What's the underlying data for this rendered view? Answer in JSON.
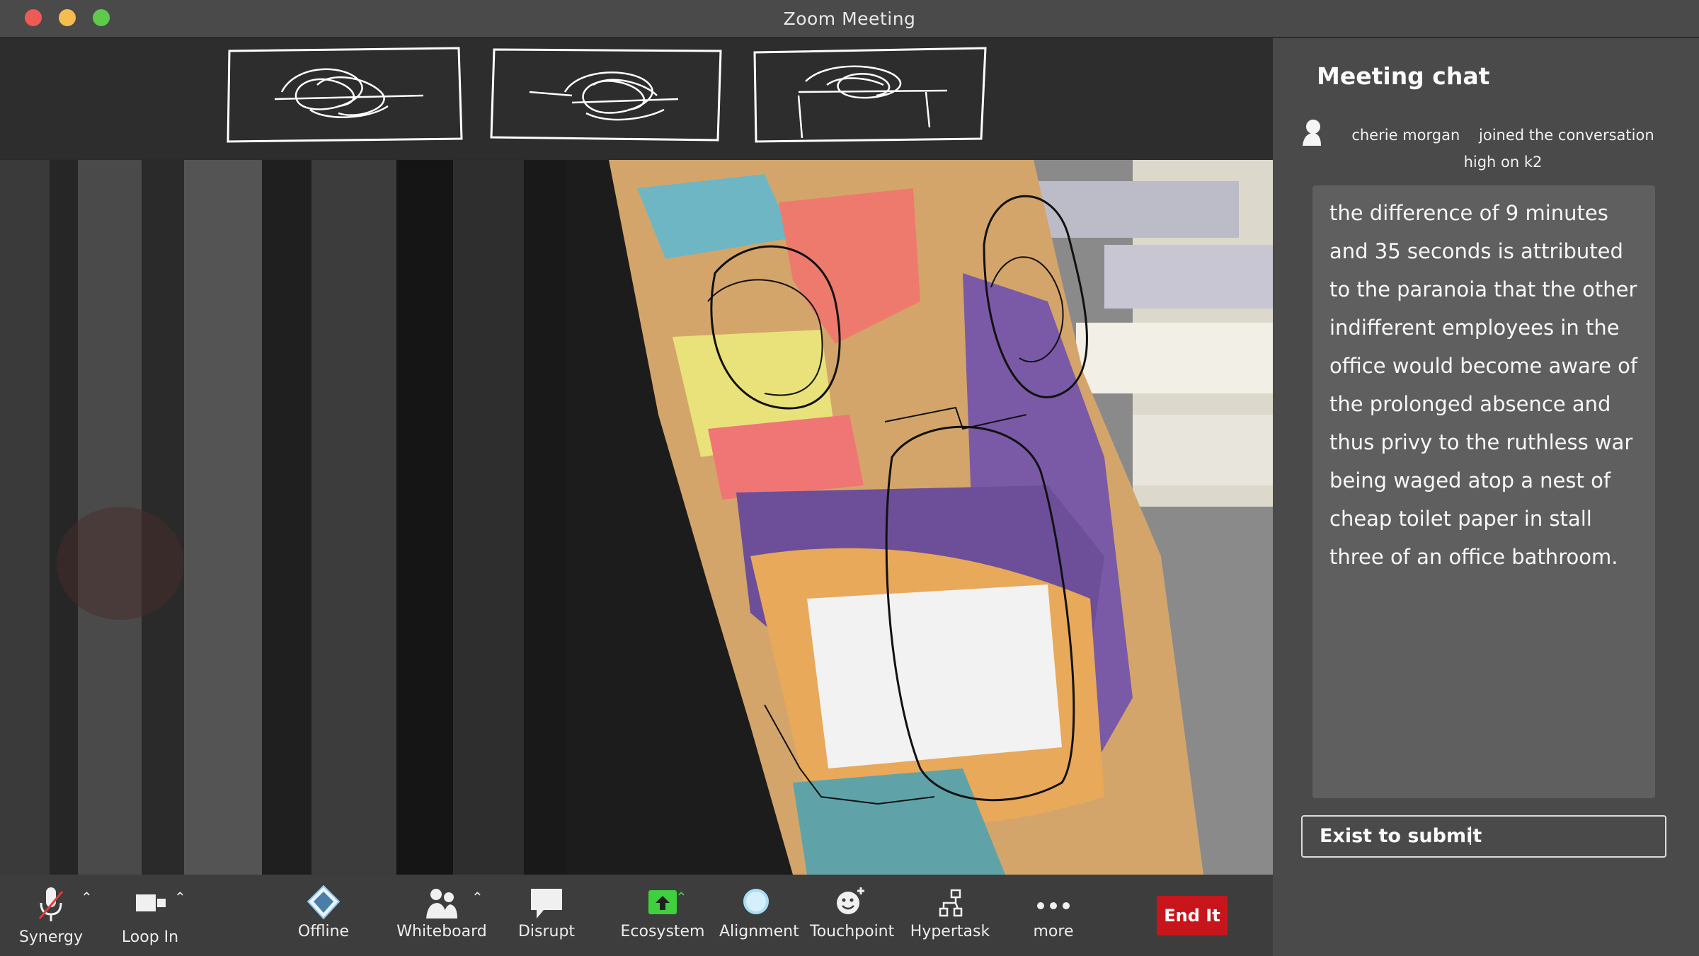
{
  "window": {
    "title": "Zoom Meeting"
  },
  "colors": {
    "end_button": "#c8151c",
    "ecosystem_accent": "#3fcf3f",
    "alignment_accent": "#a8dcf7",
    "chat_panel": "#4a4a4a",
    "message_box": "#5f5f5f"
  },
  "thumbnails": [
    {
      "icon": "scribble-face-thumbnail"
    },
    {
      "icon": "scribble-face-thumbnail"
    },
    {
      "icon": "scribble-face-thumbnail"
    }
  ],
  "chat": {
    "title": "Meeting chat",
    "join": {
      "name": "cherie morgan",
      "action": "joined the conversation",
      "location": "high on k2"
    },
    "message": "the difference of 9 minutes and 35 seconds is attributed to the paranoia that the other indifferent employees in the office would become aware of the prolonged absence and thus privy to the ruthless war being waged atop a nest of cheap toilet paper in stall three of an office bathroom.",
    "input_value": "Exist to submit"
  },
  "toolbar": {
    "synergy": "Synergy",
    "loop_in": "Loop In",
    "offline": "Offline",
    "whiteboard": "Whiteboard",
    "disrupt": "Disrupt",
    "ecosystem": "Ecosystem",
    "alignment": "Alignment",
    "touchpoint": "Touchpoint",
    "hypertask": "Hypertask",
    "more": "more",
    "end": "End It"
  }
}
